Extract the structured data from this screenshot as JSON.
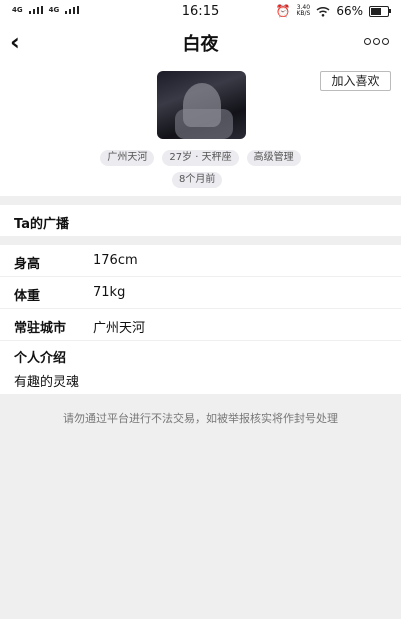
{
  "status_bar": {
    "network_1": "4G",
    "network_2": "4G",
    "time": "16:15",
    "speed_value": "3.40",
    "speed_unit": "KB/S",
    "battery": "66%"
  },
  "nav": {
    "title": "白夜"
  },
  "profile": {
    "like_button": "加入喜欢",
    "tags": [
      "广州天河",
      "27岁 · 天秤座",
      "高级管理"
    ],
    "time_tag": "8个月前"
  },
  "broadcast": {
    "title": "Ta的广播"
  },
  "details": [
    {
      "label": "身高",
      "value": "176cm"
    },
    {
      "label": "体重",
      "value": "71kg"
    },
    {
      "label": "常驻城市",
      "value": "广州天河"
    }
  ],
  "intro": {
    "title": "个人介绍",
    "text": "有趣的灵魂"
  },
  "footer": {
    "note": "请勿通过平台进行不法交易，如被举报核实将作封号处理"
  }
}
